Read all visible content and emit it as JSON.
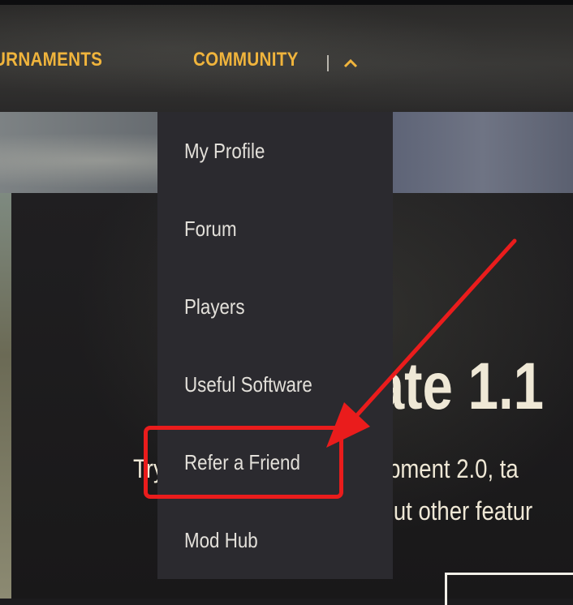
{
  "nav": {
    "items": [
      {
        "label": "URNAMENTS"
      },
      {
        "label": "COMMUNITY"
      }
    ],
    "chevron_icon": "chevron-up-icon"
  },
  "hero": {
    "title": "Update 1.1",
    "subtitle_line1": "Try out the reworked Equipment 2.0, ta",
    "subtitle_line2": "check out other featur"
  },
  "dropdown": {
    "items": [
      {
        "label": "My Profile"
      },
      {
        "label": "Forum"
      },
      {
        "label": "Players"
      },
      {
        "label": "Useful Software"
      },
      {
        "label": "Refer a Friend"
      },
      {
        "label": "Mod Hub"
      }
    ]
  },
  "annotation": {
    "color": "#ea1c1c"
  },
  "colors": {
    "nav_accent": "#f0b43c",
    "menu_bg": "#2b2a2f",
    "menu_text": "#e3e0da",
    "hero_text": "#efe8d6"
  }
}
